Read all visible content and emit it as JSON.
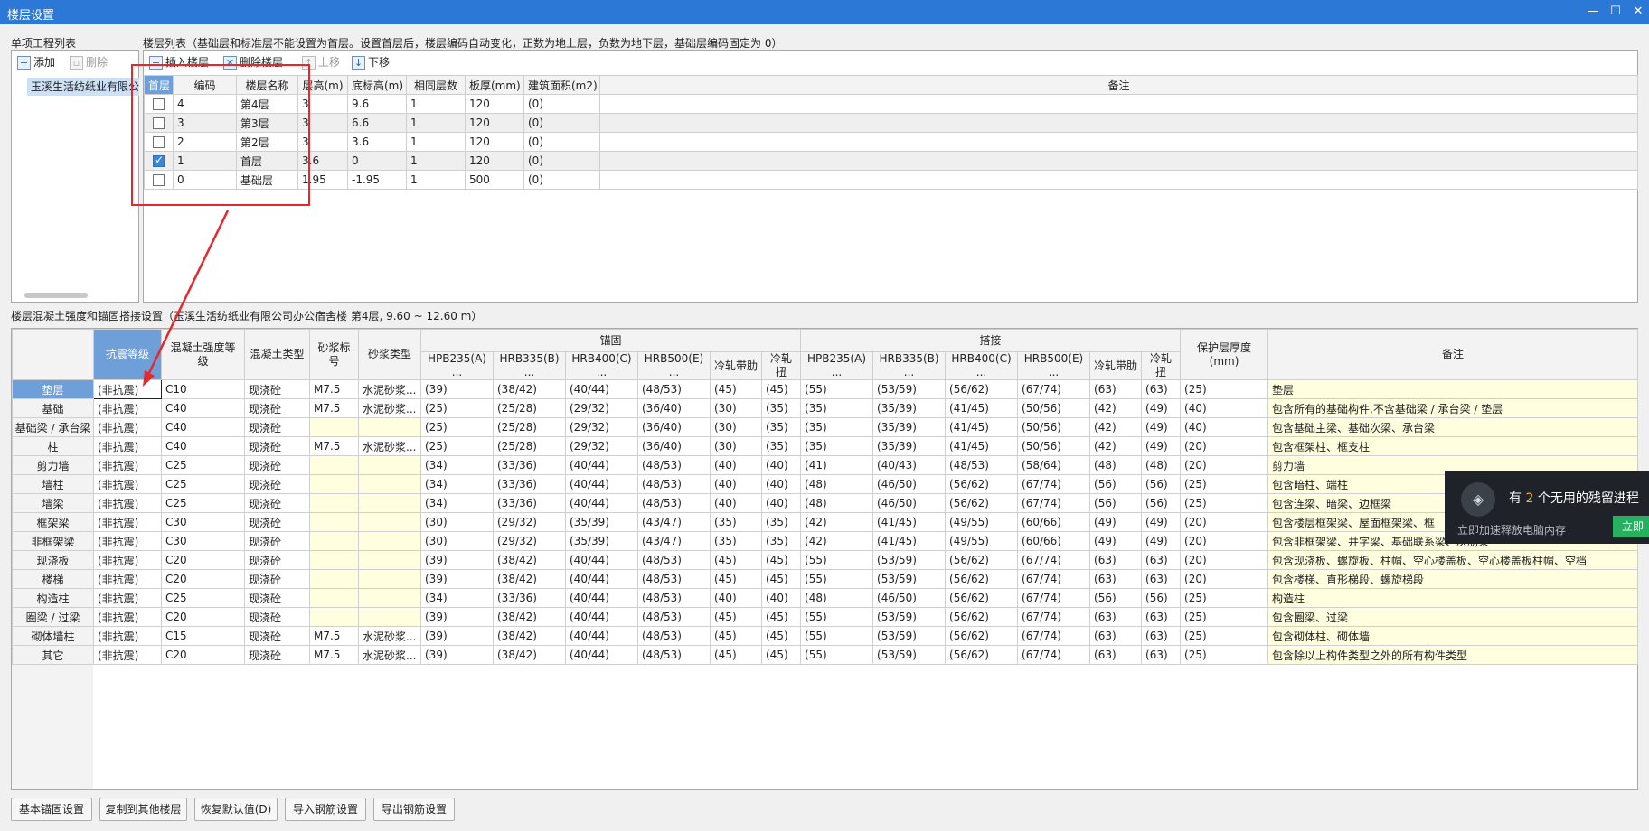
{
  "window": {
    "title": "楼层设置",
    "minimize": "—",
    "maximize": "☐",
    "close": "✕"
  },
  "project_panel": {
    "label": "单项工程列表",
    "add_label": "添加",
    "delete_label": "删除",
    "item": "玉溪生活纺纸业有限公"
  },
  "floor_panel": {
    "label": "楼层列表（基础层和标准层不能设置为首层。设置首层后，楼层编码自动变化，正数为地上层，负数为地下层，基础层编码固定为 0）",
    "toolbar": {
      "insert": "插入楼层",
      "delete": "删除楼层",
      "up": "上移",
      "down": "下移"
    },
    "columns": [
      "首层",
      "编码",
      "楼层名称",
      "层高(m)",
      "底标高(m)",
      "相同层数",
      "板厚(mm)",
      "建筑面积(m2)",
      "备注"
    ],
    "rows": [
      {
        "checked": false,
        "code": "4",
        "name": "第4层",
        "height": "3",
        "bottom": "9.6",
        "same": "1",
        "thick": "120",
        "area": "(0)",
        "note": ""
      },
      {
        "checked": false,
        "code": "3",
        "name": "第3层",
        "height": "3",
        "bottom": "6.6",
        "same": "1",
        "thick": "120",
        "area": "(0)",
        "note": ""
      },
      {
        "checked": false,
        "code": "2",
        "name": "第2层",
        "height": "3",
        "bottom": "3.6",
        "same": "1",
        "thick": "120",
        "area": "(0)",
        "note": ""
      },
      {
        "checked": true,
        "code": "1",
        "name": "首层",
        "height": "3.6",
        "bottom": "0",
        "same": "1",
        "thick": "120",
        "area": "(0)",
        "note": ""
      },
      {
        "checked": false,
        "code": "0",
        "name": "基础层",
        "height": "1.95",
        "bottom": "-1.95",
        "same": "1",
        "thick": "500",
        "area": "(0)",
        "note": ""
      }
    ]
  },
  "rebar_panel": {
    "label": "楼层混凝土强度和锚固搭接设置（玉溪生活纺纸业有限公司办公宿舍楼 第4层, 9.60 ~ 12.60 m）",
    "group_anchor": "锚固",
    "group_lap": "搭接",
    "headers": {
      "seismic": "抗震等级",
      "concrete_grade": "混凝土强度等级",
      "concrete_type": "混凝土类型",
      "mortar_grade": "砂浆标号",
      "mortar_type": "砂浆类型",
      "protect": "保护层厚度(mm)",
      "note": "备注",
      "steel": [
        "HPB235(A)\n...",
        "HRB335(B)\n...",
        "HRB400(C)\n...",
        "HRB500(E)\n...",
        "冷轧带肋",
        "冷轧扭"
      ]
    },
    "rows": [
      {
        "name": "垫层",
        "seismic": "(非抗震)",
        "cg": "C10",
        "ct": "现浇砼",
        "mg": "M7.5",
        "mt": "水泥砂浆...",
        "anchor": [
          "(39)",
          "(38/42)",
          "(40/44)",
          "(48/53)",
          "(45)",
          "(45)"
        ],
        "lap": [
          "(55)",
          "(53/59)",
          "(56/62)",
          "(67/74)",
          "(63)",
          "(63)"
        ],
        "protect": "(25)",
        "note": "垫层"
      },
      {
        "name": "基础",
        "seismic": "(非抗震)",
        "cg": "C40",
        "ct": "现浇砼",
        "mg": "M7.5",
        "mt": "水泥砂浆...",
        "anchor": [
          "(25)",
          "(25/28)",
          "(29/32)",
          "(36/40)",
          "(30)",
          "(35)"
        ],
        "lap": [
          "(35)",
          "(35/39)",
          "(41/45)",
          "(50/56)",
          "(42)",
          "(49)"
        ],
        "protect": "(40)",
        "note": "包含所有的基础构件,不含基础梁 / 承台梁 / 垫层"
      },
      {
        "name": "基础梁 / 承台梁",
        "seismic": "(非抗震)",
        "cg": "C40",
        "ct": "现浇砼",
        "mg": "",
        "mt": "",
        "anchor": [
          "(25)",
          "(25/28)",
          "(29/32)",
          "(36/40)",
          "(30)",
          "(35)"
        ],
        "lap": [
          "(35)",
          "(35/39)",
          "(41/45)",
          "(50/56)",
          "(42)",
          "(49)"
        ],
        "protect": "(40)",
        "note": "包含基础主梁、基础次梁、承台梁"
      },
      {
        "name": "柱",
        "seismic": "(非抗震)",
        "cg": "C40",
        "ct": "现浇砼",
        "mg": "M7.5",
        "mt": "水泥砂浆...",
        "anchor": [
          "(25)",
          "(25/28)",
          "(29/32)",
          "(36/40)",
          "(30)",
          "(35)"
        ],
        "lap": [
          "(35)",
          "(35/39)",
          "(41/45)",
          "(50/56)",
          "(42)",
          "(49)"
        ],
        "protect": "(20)",
        "note": "包含框架柱、框支柱"
      },
      {
        "name": "剪力墙",
        "seismic": "(非抗震)",
        "cg": "C25",
        "ct": "现浇砼",
        "mg": "",
        "mt": "",
        "anchor": [
          "(34)",
          "(33/36)",
          "(40/44)",
          "(48/53)",
          "(40)",
          "(40)"
        ],
        "lap": [
          "(41)",
          "(40/43)",
          "(48/53)",
          "(58/64)",
          "(48)",
          "(48)"
        ],
        "protect": "(20)",
        "note": "剪力墙"
      },
      {
        "name": "墙柱",
        "seismic": "(非抗震)",
        "cg": "C25",
        "ct": "现浇砼",
        "mg": "",
        "mt": "",
        "anchor": [
          "(34)",
          "(33/36)",
          "(40/44)",
          "(48/53)",
          "(40)",
          "(40)"
        ],
        "lap": [
          "(48)",
          "(46/50)",
          "(56/62)",
          "(67/74)",
          "(56)",
          "(56)"
        ],
        "protect": "(25)",
        "note": "包含暗柱、端柱"
      },
      {
        "name": "墙梁",
        "seismic": "(非抗震)",
        "cg": "C25",
        "ct": "现浇砼",
        "mg": "",
        "mt": "",
        "anchor": [
          "(34)",
          "(33/36)",
          "(40/44)",
          "(48/53)",
          "(40)",
          "(40)"
        ],
        "lap": [
          "(48)",
          "(46/50)",
          "(56/62)",
          "(67/74)",
          "(56)",
          "(56)"
        ],
        "protect": "(25)",
        "note": "包含连梁、暗梁、边框梁"
      },
      {
        "name": "框架梁",
        "seismic": "(非抗震)",
        "cg": "C30",
        "ct": "现浇砼",
        "mg": "",
        "mt": "",
        "anchor": [
          "(30)",
          "(29/32)",
          "(35/39)",
          "(43/47)",
          "(35)",
          "(35)"
        ],
        "lap": [
          "(42)",
          "(41/45)",
          "(49/55)",
          "(60/66)",
          "(49)",
          "(49)"
        ],
        "protect": "(20)",
        "note": "包含楼层框架梁、屋面框架梁、框"
      },
      {
        "name": "非框架梁",
        "seismic": "(非抗震)",
        "cg": "C30",
        "ct": "现浇砼",
        "mg": "",
        "mt": "",
        "anchor": [
          "(30)",
          "(29/32)",
          "(35/39)",
          "(43/47)",
          "(35)",
          "(35)"
        ],
        "lap": [
          "(42)",
          "(41/45)",
          "(49/55)",
          "(60/66)",
          "(49)",
          "(49)"
        ],
        "protect": "(20)",
        "note": "包含非框架梁、井字梁、基础联系梁、次肋梁"
      },
      {
        "name": "现浇板",
        "seismic": "(非抗震)",
        "cg": "C20",
        "ct": "现浇砼",
        "mg": "",
        "mt": "",
        "anchor": [
          "(39)",
          "(38/42)",
          "(40/44)",
          "(48/53)",
          "(45)",
          "(45)"
        ],
        "lap": [
          "(55)",
          "(53/59)",
          "(56/62)",
          "(67/74)",
          "(63)",
          "(63)"
        ],
        "protect": "(20)",
        "note": "包含现浇板、螺旋板、柱帽、空心楼盖板、空心楼盖板柱帽、空档"
      },
      {
        "name": "楼梯",
        "seismic": "(非抗震)",
        "cg": "C20",
        "ct": "现浇砼",
        "mg": "",
        "mt": "",
        "anchor": [
          "(39)",
          "(38/42)",
          "(40/44)",
          "(48/53)",
          "(45)",
          "(45)"
        ],
        "lap": [
          "(55)",
          "(53/59)",
          "(56/62)",
          "(67/74)",
          "(63)",
          "(63)"
        ],
        "protect": "(20)",
        "note": "包含楼梯、直形梯段、螺旋梯段"
      },
      {
        "name": "构造柱",
        "seismic": "(非抗震)",
        "cg": "C25",
        "ct": "现浇砼",
        "mg": "",
        "mt": "",
        "anchor": [
          "(34)",
          "(33/36)",
          "(40/44)",
          "(48/53)",
          "(40)",
          "(40)"
        ],
        "lap": [
          "(48)",
          "(46/50)",
          "(56/62)",
          "(67/74)",
          "(56)",
          "(56)"
        ],
        "protect": "(25)",
        "note": "构造柱"
      },
      {
        "name": "圈梁 / 过梁",
        "seismic": "(非抗震)",
        "cg": "C20",
        "ct": "现浇砼",
        "mg": "",
        "mt": "",
        "anchor": [
          "(39)",
          "(38/42)",
          "(40/44)",
          "(48/53)",
          "(45)",
          "(45)"
        ],
        "lap": [
          "(55)",
          "(53/59)",
          "(56/62)",
          "(67/74)",
          "(63)",
          "(63)"
        ],
        "protect": "(25)",
        "note": "包含圈梁、过梁"
      },
      {
        "name": "砌体墙柱",
        "seismic": "(非抗震)",
        "cg": "C15",
        "ct": "现浇砼",
        "mg": "M7.5",
        "mt": "水泥砂浆...",
        "anchor": [
          "(39)",
          "(38/42)",
          "(40/44)",
          "(48/53)",
          "(45)",
          "(45)"
        ],
        "lap": [
          "(55)",
          "(53/59)",
          "(56/62)",
          "(67/74)",
          "(63)",
          "(63)"
        ],
        "protect": "(25)",
        "note": "包含砌体柱、砌体墙"
      },
      {
        "name": "其它",
        "seismic": "(非抗震)",
        "cg": "C20",
        "ct": "现浇砼",
        "mg": "M7.5",
        "mt": "水泥砂浆...",
        "anchor": [
          "(39)",
          "(38/42)",
          "(40/44)",
          "(48/53)",
          "(45)",
          "(45)"
        ],
        "lap": [
          "(55)",
          "(53/59)",
          "(56/62)",
          "(67/74)",
          "(63)",
          "(63)"
        ],
        "protect": "(25)",
        "note": "包含除以上构件类型之外的所有构件类型"
      }
    ]
  },
  "bottom_buttons": [
    "基本锚固设置",
    "复制到其他楼层",
    "恢复默认值(D)",
    "导入钢筋设置",
    "导出钢筋设置"
  ],
  "notification": {
    "prefix": "有 ",
    "count": "2",
    "suffix": " 个无用的残留进程",
    "sub": "立即加速释放电脑内存",
    "action": "立即"
  },
  "colors": {
    "titlebar": "#2b78d6",
    "header_selected": "#6f9fd8",
    "yellow_cell": "#ffffe0",
    "annotation": "#e8272c",
    "notify_action": "#26b060"
  }
}
